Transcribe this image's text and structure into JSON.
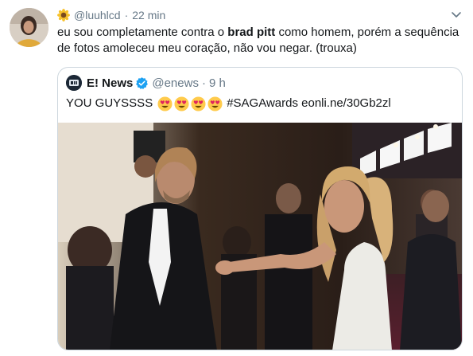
{
  "tweet": {
    "handle": "@luuhlcd",
    "separator": "·",
    "time": "22 min",
    "text_part1": "eu sou completamente contra o ",
    "text_bold": "brad pitt",
    "text_part2": " como homem, porém a sequência de fotos amoleceu meu coração, não vou negar. (trouxa)"
  },
  "quoted": {
    "name": "E! News",
    "handle": "@enews",
    "separator": "·",
    "time": "9 h",
    "text_before": "YOU GUYSSSS",
    "text_after": "#SAGAwards eonli.ne/30Gb2zl",
    "emoji_count": 4
  },
  "colors": {
    "text": "#14171a",
    "muted": "#657786",
    "border": "#ccd6dd",
    "verified": "#1da1f2"
  },
  "icons": [
    "sunflower-icon",
    "chevron-down-icon",
    "verified-badge-icon",
    "heart-eyes-emoji-icon"
  ]
}
